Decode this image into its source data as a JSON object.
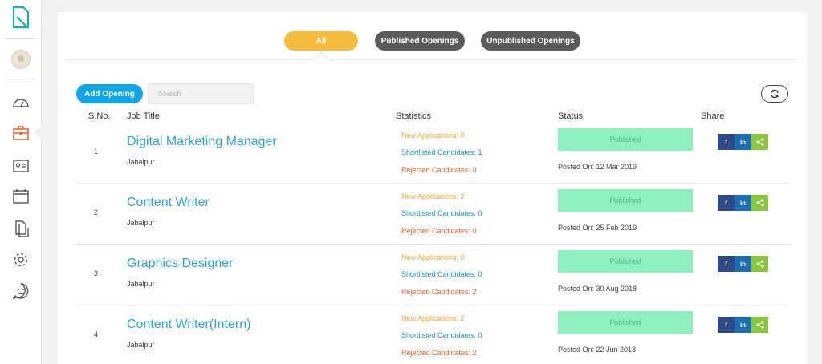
{
  "filters": {
    "all_label": "All",
    "published_label": "Published Openings",
    "unpublished_label": "Unpublished Openings"
  },
  "toolbar": {
    "add_label": "Add Opening",
    "search_placeholder": "Search"
  },
  "table": {
    "headers": {
      "sno": "S.No.",
      "job_title": "Job Title",
      "statistics": "Statistics",
      "status": "Status",
      "share": "Share"
    },
    "rows": [
      {
        "sno": "1",
        "title": "Digital Marketing Manager",
        "location": "Jabalpur",
        "new_apps": "New Applications: 0",
        "shortlisted": "Shortlisted Candidates: 1",
        "rejected": "Rejected Candidates: 0",
        "status": "Published",
        "posted": "Posted On: 12 Mar 2019"
      },
      {
        "sno": "2",
        "title": "Content Writer",
        "location": "Jabalpur",
        "new_apps": "New Applications: 2",
        "shortlisted": "Shortlisted Candidates: 0",
        "rejected": "Rejected Candidates: 0",
        "status": "Published",
        "posted": "Posted On: 25 Feb 2019"
      },
      {
        "sno": "3",
        "title": "Graphics Designer",
        "location": "Jabalpur",
        "new_apps": "New Applications: 0",
        "shortlisted": "Shortlisted Candidates: 0",
        "rejected": "Rejected Candidates: 2",
        "status": "Published",
        "posted": "Posted On: 30 Aug 2018"
      },
      {
        "sno": "4",
        "title": "Content Writer(Intern)",
        "location": "Jabalpur",
        "new_apps": "New Applications: 2",
        "shortlisted": "Shortlisted Candidates: 0",
        "rejected": "Rejected Candidates: 2",
        "status": "Published",
        "posted": "Posted On: 22 Jun 2018"
      }
    ]
  },
  "share_labels": {
    "facebook": "f",
    "linkedin": "in"
  },
  "colors": {
    "accent_all": "#f3bc3c",
    "primary": "#0ea5e9",
    "title_link": "#28a5e0",
    "published_badge": "#8ef0be",
    "sidebar_icon": "#555555",
    "sidebar_active": "#f05a28",
    "logo": "#17b3a3"
  },
  "sidebar": {
    "icons": [
      "logo-icon",
      "avatar",
      "dashboard-icon",
      "briefcase-icon",
      "id-card-icon",
      "calendar-icon",
      "documents-icon",
      "settings-icon",
      "support-icon"
    ]
  }
}
